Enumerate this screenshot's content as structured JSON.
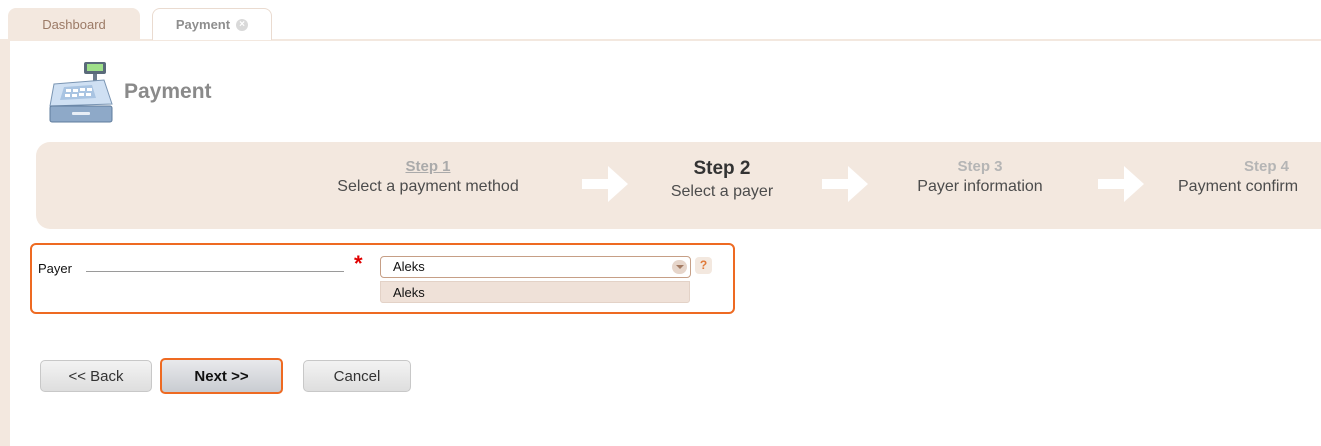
{
  "tabs": {
    "dashboard_label": "Dashboard",
    "payment_label": "Payment",
    "close_glyph": "×"
  },
  "header": {
    "title": "Payment",
    "icon": "cash-register-icon"
  },
  "steps": [
    {
      "title": "Step 1",
      "description": "Select a payment method",
      "state": "completed-link"
    },
    {
      "title": "Step 2",
      "description": "Select a payer",
      "state": "current"
    },
    {
      "title": "Step 3",
      "description": "Payer information",
      "state": "upcoming"
    },
    {
      "title": "Step 4",
      "description": "Payment confirm",
      "state": "upcoming"
    }
  ],
  "form": {
    "payer_label": "Payer",
    "required_marker": "*",
    "payer_value": "Aleks",
    "payer_options": [
      "Aleks"
    ],
    "help_glyph": "?"
  },
  "buttons": {
    "back": "<< Back",
    "next": "Next >>",
    "cancel": "Cancel"
  },
  "colors": {
    "accent": "#ee6a22",
    "band": "#f3e8df",
    "required": "#e00000"
  }
}
